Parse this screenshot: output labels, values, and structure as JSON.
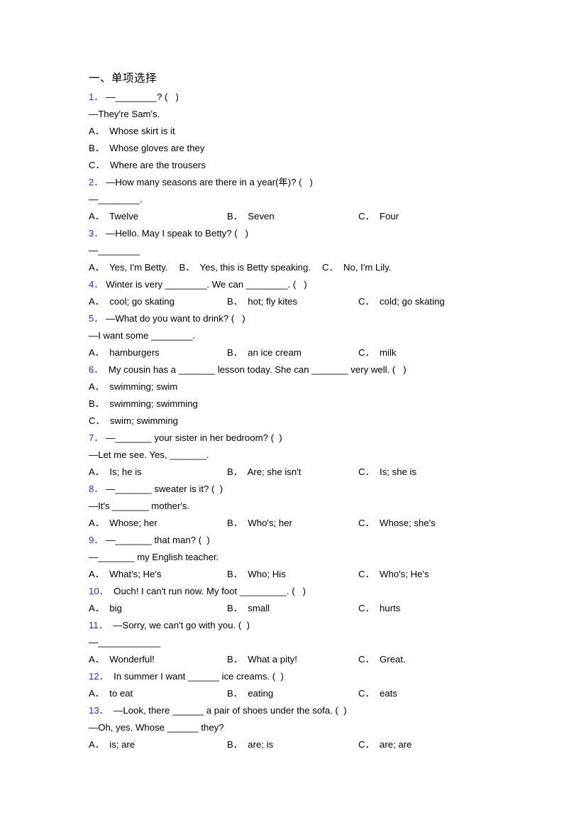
{
  "document": {
    "heading": "一、单项选择"
  },
  "questions": [
    {
      "number": "1．",
      "stem": " —________? (   )",
      "extra_lines": [
        "—They're Sam's."
      ],
      "layout": "stack",
      "options": [
        {
          "label": "A．",
          "text": "  Whose skirt is it"
        },
        {
          "label": "B．",
          "text": "  Whose gloves are they"
        },
        {
          "label": "C．",
          "text": "  Where are the trousers"
        }
      ]
    },
    {
      "number": "2．",
      "stem": " —How many seasons are there in a year(年)? (   )",
      "extra_lines": [
        "—________."
      ],
      "layout": "columns",
      "options": [
        {
          "label": "A．",
          "text": "  Twelve"
        },
        {
          "label": "B．",
          "text": "  Seven"
        },
        {
          "label": "C．",
          "text": "  Four"
        }
      ]
    },
    {
      "number": "3．",
      "stem": " —Hello. May I speak to Betty? (   )",
      "extra_lines": [
        "—________"
      ],
      "layout": "flow",
      "options": [
        {
          "label": "A．",
          "text": "  Yes, I'm Betty."
        },
        {
          "label": "B．",
          "text": "  Yes, this is Betty speaking."
        },
        {
          "label": "C．",
          "text": "  No, I'm Lily."
        }
      ]
    },
    {
      "number": "4．",
      "stem": " Winter is very ________. We can ________. (   )",
      "extra_lines": [],
      "layout": "columns",
      "options": [
        {
          "label": "A．",
          "text": "  cool; go skating"
        },
        {
          "label": "B．",
          "text": "  hot; fly kites"
        },
        {
          "label": "C．",
          "text": "  cold; go skating"
        }
      ]
    },
    {
      "number": "5．",
      "stem": " —What do you want to drink? (   )",
      "extra_lines": [
        "—I want some ________."
      ],
      "layout": "columns",
      "options": [
        {
          "label": "A．",
          "text": "  hamburgers"
        },
        {
          "label": "B．",
          "text": "  an ice cream"
        },
        {
          "label": "C．",
          "text": "  milk"
        }
      ]
    },
    {
      "number": "6．",
      "stem": "  My cousin has a _______ lesson today. She can _______ very well. (   )",
      "extra_lines": [],
      "layout": "stack",
      "options": [
        {
          "label": "A．",
          "text": "  swimming; swim"
        },
        {
          "label": "B．",
          "text": "  swimming; swimming"
        },
        {
          "label": "C．",
          "text": "  swim; swimming"
        }
      ]
    },
    {
      "number": "7．",
      "stem": " —_______ your sister in her bedroom? (  )",
      "extra_lines": [
        "—Let me see. Yes, _______."
      ],
      "layout": "columns",
      "options": [
        {
          "label": "A．",
          "text": "  Is; he is"
        },
        {
          "label": "B．",
          "text": "  Are; she isn't"
        },
        {
          "label": "C．",
          "text": "  Is; she is"
        }
      ]
    },
    {
      "number": "8．",
      "stem": " —_______ sweater is it? (  )",
      "extra_lines": [
        "—It's _______ mother's."
      ],
      "layout": "columns",
      "options": [
        {
          "label": "A．",
          "text": "  Whose; her"
        },
        {
          "label": "B．",
          "text": "  Who's; her"
        },
        {
          "label": "C．",
          "text": "  Whose; she's"
        }
      ]
    },
    {
      "number": "9．",
      "stem": " —_______ that man? (  )",
      "extra_lines": [
        "—_______ my English teacher."
      ],
      "layout": "columns",
      "options": [
        {
          "label": "A．",
          "text": "  What's; He's"
        },
        {
          "label": "B．",
          "text": "  Who; His"
        },
        {
          "label": "C．",
          "text": "  Who's; He's"
        }
      ]
    },
    {
      "number": "10．",
      "stem": "  Ouch! I can't run now. My foot _________. (   )",
      "extra_lines": [],
      "layout": "columns",
      "options": [
        {
          "label": "A．",
          "text": "  big"
        },
        {
          "label": "B．",
          "text": "  small"
        },
        {
          "label": "C．",
          "text": "  hurts"
        }
      ]
    },
    {
      "number": "11．",
      "stem": "  —Sorry, we can't go with you. (  )",
      "extra_lines": [
        "—____________"
      ],
      "layout": "columns",
      "options": [
        {
          "label": "A．",
          "text": "  Wonderful!"
        },
        {
          "label": "B．",
          "text": "  What a pity!"
        },
        {
          "label": "C．",
          "text": "  Great."
        }
      ]
    },
    {
      "number": "12．",
      "stem": "  In summer I want ______ ice creams. (  )",
      "extra_lines": [],
      "layout": "columns",
      "options": [
        {
          "label": "A．",
          "text": "  to eat"
        },
        {
          "label": "B．",
          "text": "  eating"
        },
        {
          "label": "C．",
          "text": "  eats"
        }
      ]
    },
    {
      "number": "13．",
      "stem": "  —Look, there ______ a pair of shoes under the sofa. (  )",
      "extra_lines": [
        "—Oh, yes. Whose ______ they?"
      ],
      "layout": "columns",
      "options": [
        {
          "label": "A．",
          "text": "  is; are"
        },
        {
          "label": "B．",
          "text": "  are; is"
        },
        {
          "label": "C．",
          "text": "  are; are"
        }
      ]
    }
  ],
  "colors": {
    "question_number": "#2f2fc4",
    "body_text": "#000000",
    "page_background": "#ffffff"
  }
}
